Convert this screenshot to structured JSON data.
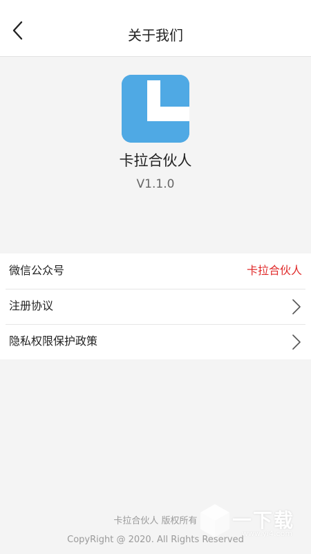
{
  "header": {
    "title": "关于我们",
    "back_icon": "chevron-left-icon"
  },
  "app": {
    "name": "卡拉合伙人",
    "version": "V1.1.0",
    "logo_color": "#4fa9e4"
  },
  "settings": {
    "items": [
      {
        "label": "微信公众号",
        "value": "卡拉合伙人",
        "value_color": "#e02a2a"
      },
      {
        "label": "注册协议",
        "icon": "chevron-right-icon"
      },
      {
        "label": "隐私权限保护政策",
        "icon": "chevron-right-icon"
      }
    ]
  },
  "footer": {
    "owner": "卡拉合伙人 版权所有",
    "copyright": "CopyRight @ 2020. All Rights Reserved"
  },
  "watermark": {
    "text": "一下载",
    "url": "www.yi4.com"
  }
}
